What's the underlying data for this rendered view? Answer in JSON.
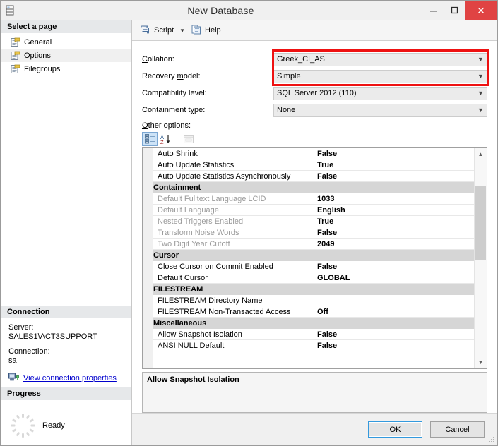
{
  "window": {
    "title": "New Database",
    "icon": "database-icon",
    "controls": {
      "minimize": "–",
      "maximize": "□",
      "close": "✕"
    }
  },
  "sidebar": {
    "select_page_header": "Select a page",
    "pages": [
      {
        "label": "General",
        "selected": false,
        "icon": "page-icon"
      },
      {
        "label": "Options",
        "selected": true,
        "icon": "page-icon"
      },
      {
        "label": "Filegroups",
        "selected": false,
        "icon": "page-icon"
      }
    ],
    "connection": {
      "header": "Connection",
      "server_label": "Server:",
      "server_value": "SALES1\\ACT3SUPPORT",
      "connection_label": "Connection:",
      "connection_value": "sa",
      "link_label": "View connection properties",
      "link_icon": "connection-properties-icon"
    },
    "progress": {
      "header": "Progress",
      "status": "Ready",
      "spinner_icon": "progress-spinner-icon"
    }
  },
  "toolbar": {
    "script_label": "Script",
    "script_icon": "script-icon",
    "dropdown_icon": "chevron-down-icon",
    "help_label": "Help",
    "help_icon": "help-icon"
  },
  "fields": {
    "other_options_label": "Other options:",
    "rows": [
      {
        "label": "Collation:",
        "accel": 1,
        "value": "Greek_CI_AS",
        "highlighted": true
      },
      {
        "label": "Recovery model:",
        "accel": 11,
        "value": "Simple",
        "highlighted": true
      },
      {
        "label": "Compatibility level:",
        "accel": -1,
        "value": "SQL Server 2012 (110)",
        "highlighted": false
      },
      {
        "label": "Containment type:",
        "accel": 12,
        "value": "None",
        "highlighted": false
      }
    ]
  },
  "grid_toolbar": {
    "categorized_icon": "categorized-view-icon",
    "alphabetical_icon": "alphabetical-sort-icon",
    "property_pages_icon": "property-pages-icon"
  },
  "property_grid": {
    "rows": [
      {
        "kind": "prop",
        "name": "Auto Shrink",
        "value": "False",
        "disabled": false
      },
      {
        "kind": "prop",
        "name": "Auto Update Statistics",
        "value": "True",
        "disabled": false
      },
      {
        "kind": "prop",
        "name": "Auto Update Statistics Asynchronously",
        "value": "False",
        "disabled": false
      },
      {
        "kind": "cat",
        "name": "Containment",
        "value": "",
        "disabled": false
      },
      {
        "kind": "prop",
        "name": "Default Fulltext Language LCID",
        "value": "1033",
        "disabled": true
      },
      {
        "kind": "prop",
        "name": "Default Language",
        "value": "English",
        "disabled": true
      },
      {
        "kind": "prop",
        "name": "Nested Triggers Enabled",
        "value": "True",
        "disabled": true
      },
      {
        "kind": "prop",
        "name": "Transform Noise Words",
        "value": "False",
        "disabled": true
      },
      {
        "kind": "prop",
        "name": "Two Digit Year Cutoff",
        "value": "2049",
        "disabled": true
      },
      {
        "kind": "cat",
        "name": "Cursor",
        "value": "",
        "disabled": false
      },
      {
        "kind": "prop",
        "name": "Close Cursor on Commit Enabled",
        "value": "False",
        "disabled": false
      },
      {
        "kind": "prop",
        "name": "Default Cursor",
        "value": "GLOBAL",
        "disabled": false
      },
      {
        "kind": "cat",
        "name": "FILESTREAM",
        "value": "",
        "disabled": false
      },
      {
        "kind": "prop",
        "name": "FILESTREAM Directory Name",
        "value": "",
        "disabled": false
      },
      {
        "kind": "prop",
        "name": "FILESTREAM Non-Transacted Access",
        "value": "Off",
        "disabled": false
      },
      {
        "kind": "cat",
        "name": "Miscellaneous",
        "value": "",
        "disabled": false
      },
      {
        "kind": "prop",
        "name": "Allow Snapshot Isolation",
        "value": "False",
        "disabled": false
      },
      {
        "kind": "prop",
        "name": "ANSI NULL Default",
        "value": "False",
        "disabled": false
      }
    ],
    "scrollbar": {
      "up_icon": "chevron-up-icon",
      "down_icon": "chevron-down-icon",
      "thumb_top_pct": 13,
      "thumb_height_pct": 38
    }
  },
  "description": {
    "title": "Allow Snapshot Isolation",
    "text": ""
  },
  "footer": {
    "ok_label": "OK",
    "cancel_label": "Cancel"
  },
  "colors": {
    "highlight_red": "#ee1111",
    "accent_blue": "#3399dd",
    "link_blue": "#0000cc",
    "close_red": "#e04343"
  }
}
